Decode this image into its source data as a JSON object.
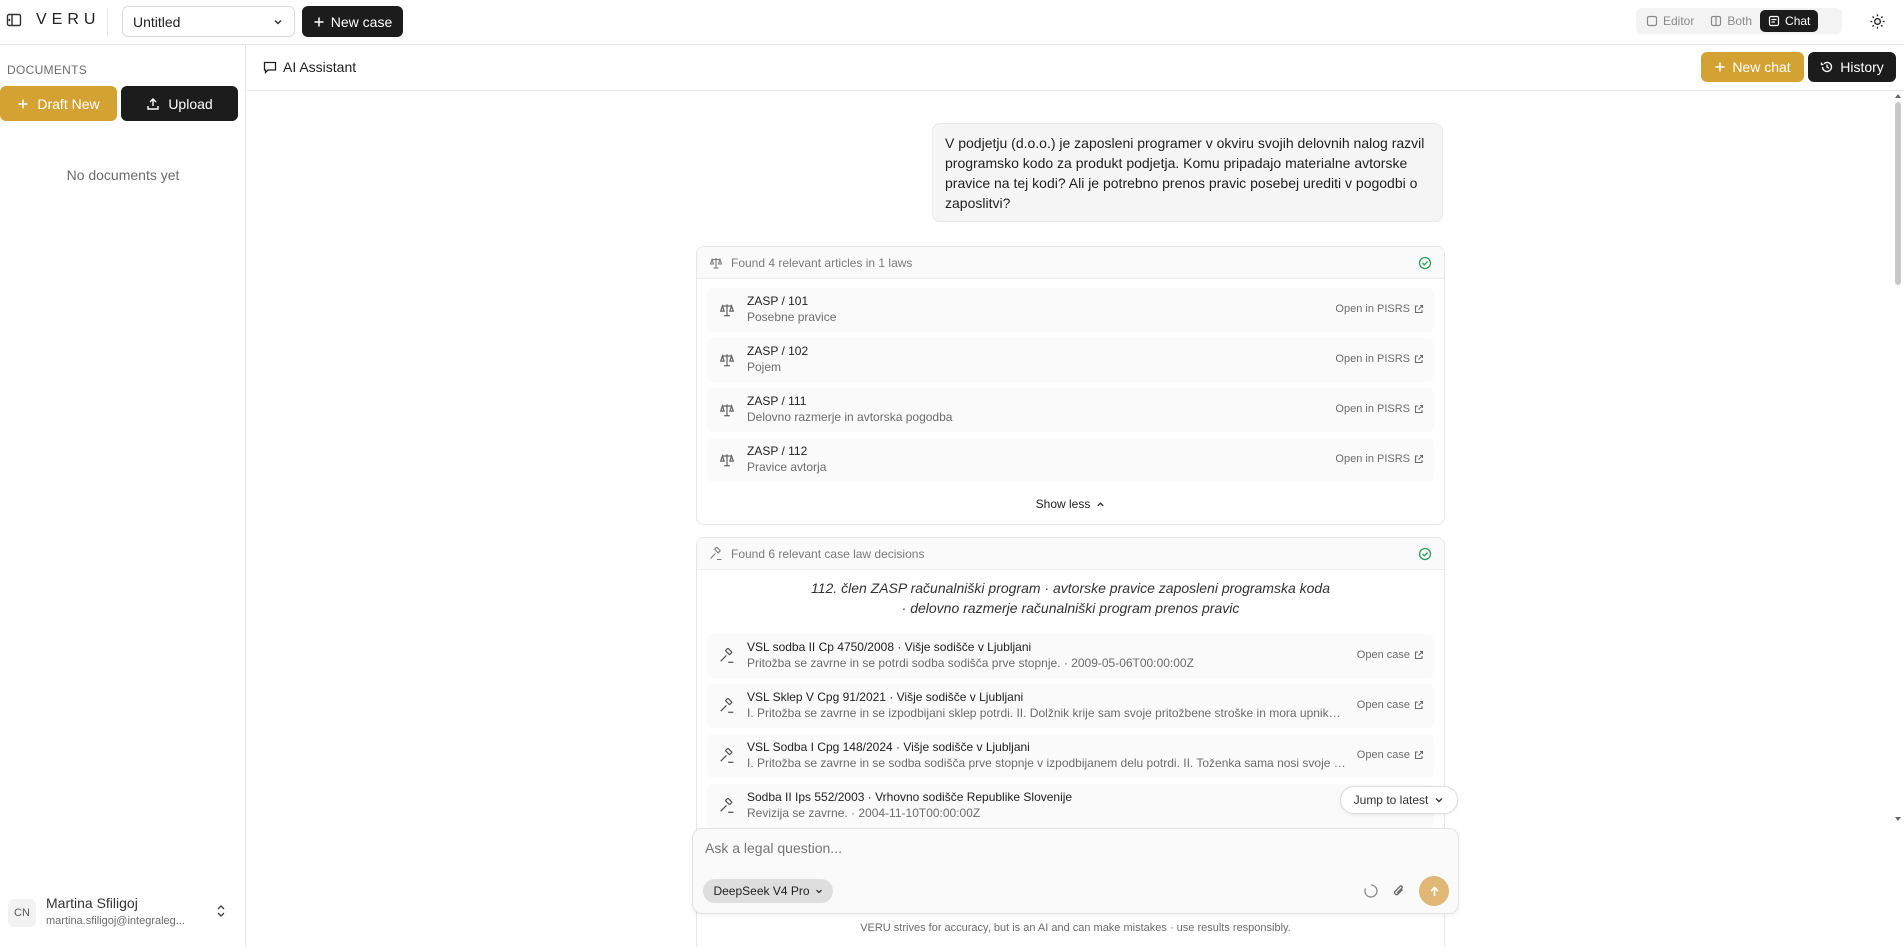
{
  "app": {
    "logo": "VERU"
  },
  "topbar": {
    "case_select_value": "Untitled",
    "new_case_label": "New case",
    "views": [
      {
        "label": "Editor",
        "active": false
      },
      {
        "label": "Both",
        "active": false
      },
      {
        "label": "Chat",
        "active": true
      }
    ]
  },
  "sidebar": {
    "section_label": "DOCUMENTS",
    "draft_new_label": "Draft New",
    "upload_label": "Upload",
    "empty_text": "No documents yet",
    "user": {
      "initials": "CN",
      "name": "Martina Sfiligoj",
      "email": "martina.sfiligoj@integraleg..."
    }
  },
  "chat_header": {
    "title": "AI Assistant",
    "new_chat_label": "New chat",
    "history_label": "History"
  },
  "chat": {
    "user_message": "V podjetju (d.o.o.) je zaposleni programer v okviru svojih delovnih nalog razvil programsko kodo za produkt podjetja. Komu pripadajo materialne avtorske pravice na tej kodi? Ali je potrebno prenos pravic posebej urediti v pogodbi o zaposlitvi?",
    "laws": {
      "header": "Found 4 relevant articles in 1 laws",
      "open_label": "Open in PISRS",
      "items": [
        {
          "title": "ZASP / 101",
          "subtitle": "Posebne pravice"
        },
        {
          "title": "ZASP / 102",
          "subtitle": "Pojem"
        },
        {
          "title": "ZASP / 111",
          "subtitle": "Delovno razmerje in avtorska pogodba"
        },
        {
          "title": "ZASP / 112",
          "subtitle": "Pravice avtorja"
        }
      ],
      "show_less_label": "Show less"
    },
    "cases": {
      "header": "Found 6 relevant case law decisions",
      "keywords_line1": "112. člen ZASP računalniški program  ·  avtorske pravice zaposleni programska koda",
      "keywords_line2": "·  delovno razmerje računalniški program prenos pravic",
      "open_label": "Open case",
      "items": [
        {
          "title": "VSL sodba II Cp 4750/2008 · Višje sodišče v Ljubljani",
          "subtitle": "Pritožba se zavrne in se potrdi sodba sodišča prve stopnje. · 2009-05-06T00:00:00Z"
        },
        {
          "title": "VSL Sklep V Cpg 91/2021 · Višje sodišče v Ljubljani",
          "subtitle": "I. Pritožba se zavrne in se izpodbijani sklep potrdi. II. Dolžnik krije sam svoje pritožbene stroške in mora upniku povrniti njegove stroške."
        },
        {
          "title": "VSL Sodba I Cpg 148/2024 · Višje sodišče v Ljubljani",
          "subtitle": "I. Pritožba se zavrne in se sodba sodišča prve stopnje v izpodbijanem delu potrdi. II. Toženka sama nosi svoje stroške pritožbenega postopka."
        },
        {
          "title": "Sodba II Ips 552/2003 · Vrhovno sodišče Republike Slovenije",
          "subtitle": "Revizija se zavrne. · 2004-11-10T00:00:00Z"
        }
      ]
    },
    "jump_latest_label": "Jump to latest"
  },
  "composer": {
    "placeholder": "Ask a legal question...",
    "model": "DeepSeek V4 Pro",
    "disclaimer": "VERU strives for accuracy, but is an AI and can make mistakes · use results responsibly."
  }
}
